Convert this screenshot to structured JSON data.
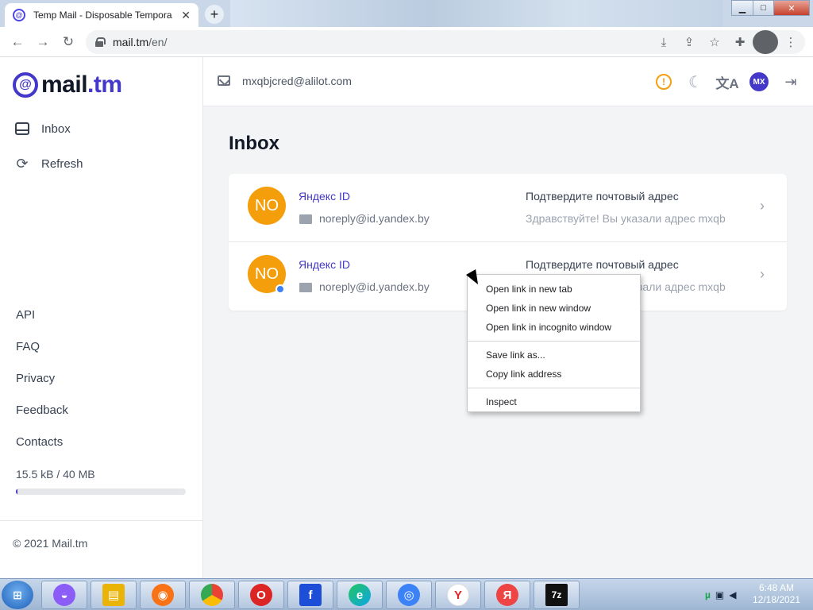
{
  "browser": {
    "tab_title": "Temp Mail - Disposable Tempora",
    "tab_close": "✕",
    "new_tab": "+",
    "url_host": "mail.tm",
    "url_path": "/en/",
    "window_controls": {
      "minimize": "▁",
      "maximize": "□",
      "close": "✕"
    }
  },
  "sidebar": {
    "logo_text": "mail",
    "logo_tld": ".tm",
    "nav": [
      {
        "label": "Inbox",
        "icon": "inbox-icon"
      },
      {
        "label": "Refresh",
        "icon": "refresh-icon"
      }
    ],
    "footer_links": [
      "API",
      "FAQ",
      "Privacy",
      "Feedback",
      "Contacts"
    ],
    "storage_text": "15.5 kB  / 40 MB",
    "storage_used_fraction": 0.0004,
    "copyright": "© 2021 Mail.tm"
  },
  "header": {
    "account_email": "mxqbjcred@alilot.com",
    "avatar_initials": "MX"
  },
  "main": {
    "title": "Inbox",
    "messages": [
      {
        "avatar": "NO",
        "sender": "Яндекс ID",
        "from": "noreply@id.yandex.by",
        "subject": "Подтвердите почтовый адрес",
        "preview": "Здравствуйте! Вы указали адрес mxqb",
        "unread": false
      },
      {
        "avatar": "NO",
        "sender": "Яндекс ID",
        "from": "noreply@id.yandex.by",
        "subject": "Подтвердите почтовый адрес",
        "preview": "Здравствуйте! Вы указали адрес mxqb",
        "unread": true
      }
    ]
  },
  "context_menu": {
    "items": [
      "Open link in new tab",
      "Open link in new window",
      "Open link in incognito window",
      "Save link as...",
      "Copy link address",
      "Inspect"
    ]
  },
  "taskbar": {
    "time": "6:48 AM",
    "date": "12/18/2021"
  },
  "colors": {
    "accent": "#4338ca",
    "avatar_bg": "#f59e0b",
    "unread_dot": "#3b82f6",
    "warning": "#f59e0b"
  }
}
